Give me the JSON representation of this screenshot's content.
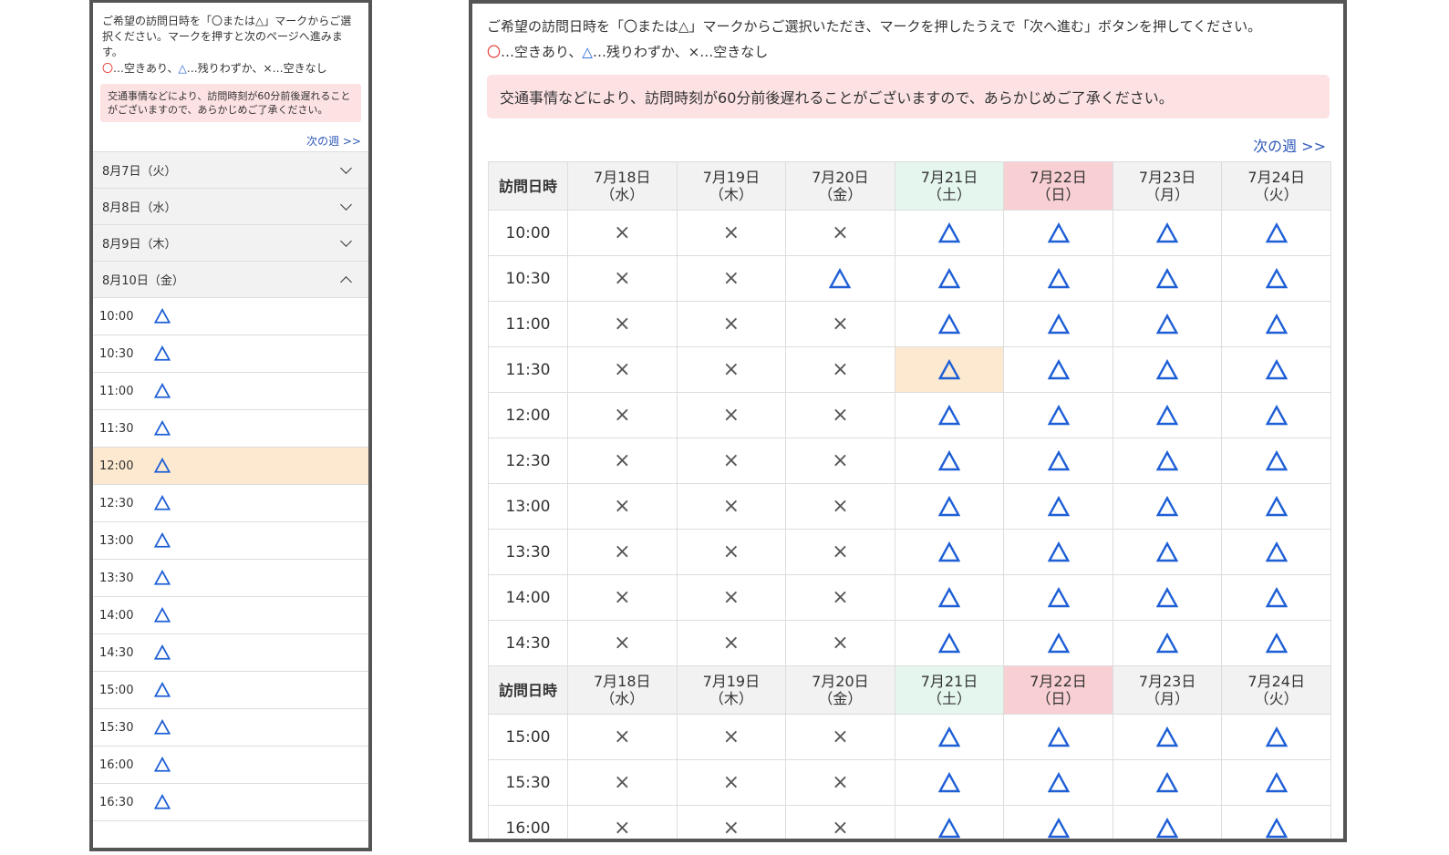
{
  "mobile": {
    "intro": "ご希望の訪問日時を「〇または△」マークからご選択ください。マークを押すと次のページへ進みます。",
    "legend": {
      "circle": "〇",
      "circle_text": "…空きあり、",
      "triangle": "△",
      "triangle_text": "…残りわずか、",
      "cross": "×",
      "cross_text": "…空きなし"
    },
    "notice": "交通事情などにより、訪問時刻が60分前後遅れることがございますので、あらかじめご了承ください。",
    "next_week": "次の週 >>",
    "days": [
      {
        "label": "8月7日（火）",
        "expanded": false
      },
      {
        "label": "8月8日（水）",
        "expanded": false
      },
      {
        "label": "8月9日（木）",
        "expanded": false
      },
      {
        "label": "8月10日（金）",
        "expanded": true
      }
    ],
    "slots": [
      {
        "time": "10:00",
        "mark": "△",
        "selected": false
      },
      {
        "time": "10:30",
        "mark": "△",
        "selected": false
      },
      {
        "time": "11:00",
        "mark": "△",
        "selected": false
      },
      {
        "time": "11:30",
        "mark": "△",
        "selected": false
      },
      {
        "time": "12:00",
        "mark": "△",
        "selected": true
      },
      {
        "time": "12:30",
        "mark": "△",
        "selected": false
      },
      {
        "time": "13:00",
        "mark": "△",
        "selected": false
      },
      {
        "time": "13:30",
        "mark": "△",
        "selected": false
      },
      {
        "time": "14:00",
        "mark": "△",
        "selected": false
      },
      {
        "time": "14:30",
        "mark": "△",
        "selected": false
      },
      {
        "time": "15:00",
        "mark": "△",
        "selected": false
      },
      {
        "time": "15:30",
        "mark": "△",
        "selected": false
      },
      {
        "time": "16:00",
        "mark": "△",
        "selected": false
      },
      {
        "time": "16:30",
        "mark": "△",
        "selected": false
      }
    ]
  },
  "desktop": {
    "intro": "ご希望の訪問日時を「〇または△」マークからご選択いただき、マークを押したうえで「次へ進む」ボタンを押してください。",
    "legend": {
      "circle": "〇",
      "circle_text": "…空きあり、",
      "triangle": "△",
      "triangle_text": "…残りわずか、",
      "cross": "×",
      "cross_text": "…空きなし"
    },
    "notice": "交通事情などにより、訪問時刻が60分前後遅れることがございますので、あらかじめご了承ください。",
    "next_week": "次の週 >>",
    "corner_label": "訪問日時",
    "days": [
      {
        "date": "7月18日",
        "weekday": "（水）",
        "type": "weekday"
      },
      {
        "date": "7月19日",
        "weekday": "（木）",
        "type": "weekday"
      },
      {
        "date": "7月20日",
        "weekday": "（金）",
        "type": "weekday"
      },
      {
        "date": "7月21日",
        "weekday": "（土）",
        "type": "sat"
      },
      {
        "date": "7月22日",
        "weekday": "（日）",
        "type": "sun"
      },
      {
        "date": "7月23日",
        "weekday": "（月）",
        "type": "weekday"
      },
      {
        "date": "7月24日",
        "weekday": "（火）",
        "type": "weekday"
      }
    ],
    "rows": [
      {
        "time": "10:00",
        "marks": [
          "×",
          "×",
          "×",
          "△",
          "△",
          "△",
          "△"
        ]
      },
      {
        "time": "10:30",
        "marks": [
          "×",
          "×",
          "△",
          "△",
          "△",
          "△",
          "△"
        ]
      },
      {
        "time": "11:00",
        "marks": [
          "×",
          "×",
          "×",
          "△",
          "△",
          "△",
          "△"
        ]
      },
      {
        "time": "11:30",
        "marks": [
          "×",
          "×",
          "×",
          "△",
          "△",
          "△",
          "△"
        ],
        "highlight": 3
      },
      {
        "time": "12:00",
        "marks": [
          "×",
          "×",
          "×",
          "△",
          "△",
          "△",
          "△"
        ]
      },
      {
        "time": "12:30",
        "marks": [
          "×",
          "×",
          "×",
          "△",
          "△",
          "△",
          "△"
        ]
      },
      {
        "time": "13:00",
        "marks": [
          "×",
          "×",
          "×",
          "△",
          "△",
          "△",
          "△"
        ]
      },
      {
        "time": "13:30",
        "marks": [
          "×",
          "×",
          "×",
          "△",
          "△",
          "△",
          "△"
        ]
      },
      {
        "time": "14:00",
        "marks": [
          "×",
          "×",
          "×",
          "△",
          "△",
          "△",
          "△"
        ]
      },
      {
        "time": "14:30",
        "marks": [
          "×",
          "×",
          "×",
          "△",
          "△",
          "△",
          "△"
        ]
      },
      {
        "header": true
      },
      {
        "time": "15:00",
        "marks": [
          "×",
          "×",
          "×",
          "△",
          "△",
          "△",
          "△"
        ]
      },
      {
        "time": "15:30",
        "marks": [
          "×",
          "×",
          "×",
          "△",
          "△",
          "△",
          "△"
        ]
      },
      {
        "time": "16:00",
        "marks": [
          "×",
          "×",
          "×",
          "△",
          "△",
          "△",
          "△"
        ]
      }
    ]
  },
  "colors": {
    "circle": "#e53935",
    "triangle": "#1e5fd6",
    "selected": "#fde9cf",
    "saturday": "#e5f6ef",
    "sunday": "#f8cfd2",
    "notice": "#fde2e4",
    "link": "#2f58b8"
  }
}
